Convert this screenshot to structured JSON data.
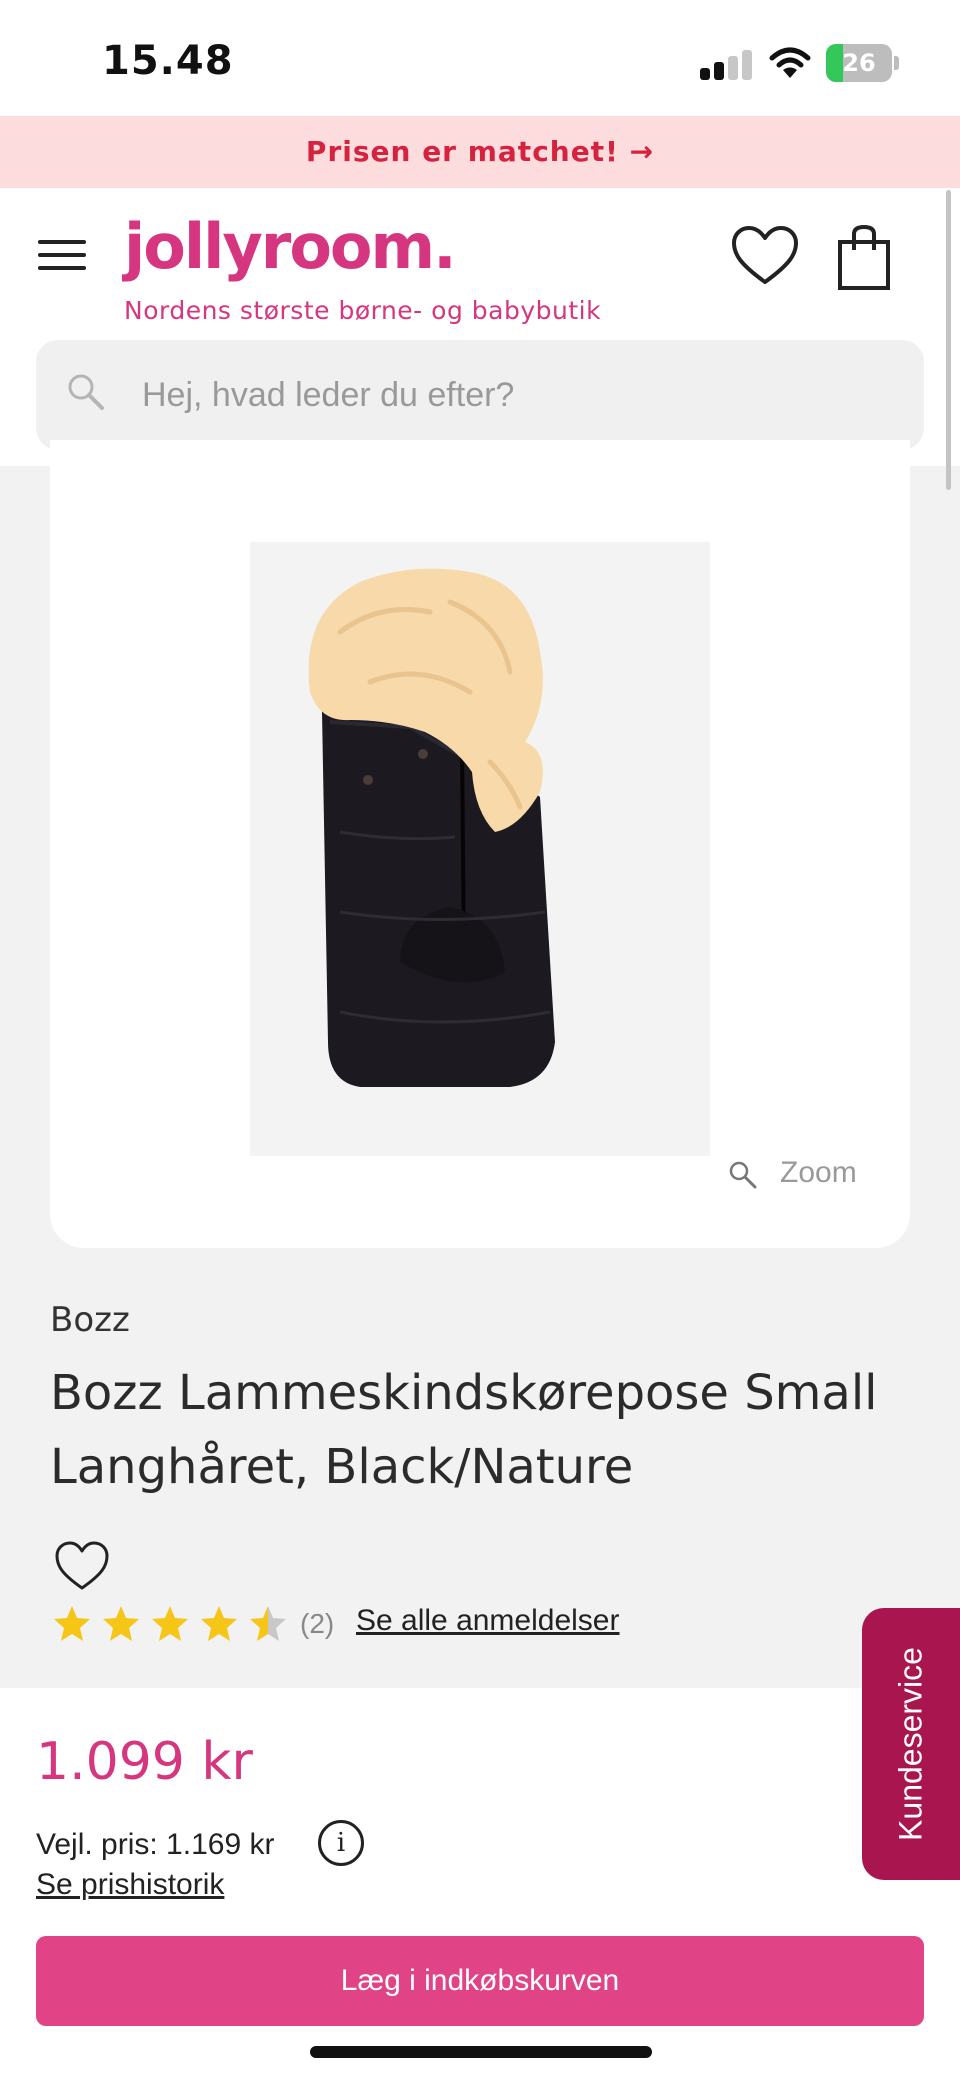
{
  "status_bar": {
    "time": "15.48",
    "battery_percent": "26",
    "signal_bars": 2,
    "icons": [
      "signal-icon",
      "wifi-icon",
      "battery-charging-icon"
    ]
  },
  "promo_banner": {
    "text": "Prisen er matchet! →",
    "color": "#d4223f",
    "background": "#fcdcdc"
  },
  "header": {
    "logo": "jollyroom.",
    "tagline": "Nordens største børne- og babybutik",
    "brand_color": "#d6367f",
    "icons": [
      "menu-icon",
      "heart-icon",
      "shopping-bag-icon"
    ]
  },
  "search": {
    "placeholder": "Hej, hvad leder du efter?"
  },
  "product": {
    "image_alt": "Black footmuff with natural lambskin lining",
    "zoom_label": "Zoom",
    "brand": "Bozz",
    "title": "Bozz Lammeskindskørepose Small Langhåret, Black/Nature",
    "rating": 4.5,
    "rating_max": 5,
    "review_count": "(2)",
    "reviews_link": "Se alle anmeldelser",
    "star_color": "#f5c518"
  },
  "pricing": {
    "price": "1.099 kr",
    "recommended_price": "Vejl. pris: 1.169 kr",
    "info_glyph": "i",
    "price_history_link": "Se prishistorik",
    "add_to_cart": "Læg i indkøbskurven",
    "button_color": "#e04386"
  },
  "customer_service": {
    "label": "Kundeservice",
    "color": "#a8154f"
  }
}
